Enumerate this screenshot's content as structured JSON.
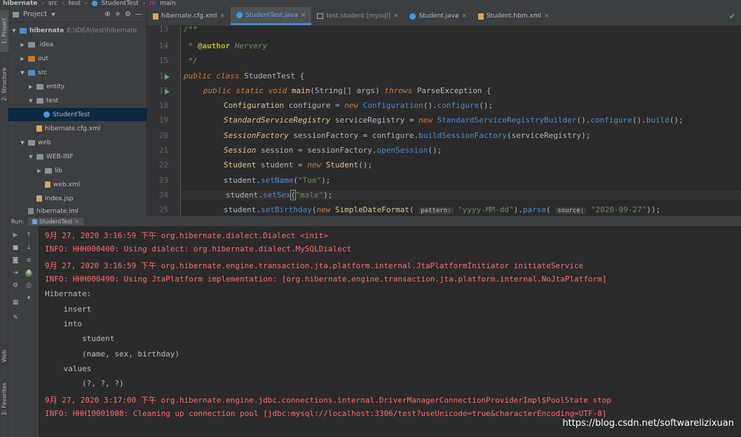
{
  "breadcrumb": [
    "hibernate",
    "src",
    "test",
    "StudentTest",
    "main"
  ],
  "left_tabs": [
    "1: Project",
    "2: Structure",
    "Web",
    "2: Favorites"
  ],
  "project_panel": {
    "title": "Project",
    "tree": [
      {
        "label": "hibernate",
        "path": "E:\\IDEA\\test\\hibernate"
      },
      {
        "label": ".idea"
      },
      {
        "label": "out"
      },
      {
        "label": "src"
      },
      {
        "label": "entity"
      },
      {
        "label": "test"
      },
      {
        "label": "StudentTest"
      },
      {
        "label": "hibernate.cfg.xml"
      },
      {
        "label": "web"
      },
      {
        "label": "WEB-INF"
      },
      {
        "label": "lib"
      },
      {
        "label": "web.xml"
      },
      {
        "label": "index.jsp"
      },
      {
        "label": "hibernate.iml"
      }
    ]
  },
  "tabs": [
    {
      "label": "hibernate.cfg.xml"
    },
    {
      "label": "StudentTest.java"
    },
    {
      "label": "test.student [mysql]"
    },
    {
      "label": "Student.java"
    },
    {
      "label": "Student.hbm.xml"
    }
  ],
  "editor": {
    "line_numbers": [
      "13",
      "14",
      "15",
      "16",
      "17",
      "18",
      "19",
      "20",
      "21",
      "22",
      "23",
      "24",
      "25"
    ],
    "lines": {
      "l13": "/**",
      "l14_star": " * ",
      "l14_tag": "@author",
      "l14_name": " Hervery",
      "l15": " */",
      "l16_kw1": "public",
      "l16_kw2": "class",
      "l16_name": " StudentTest {",
      "l17_kw1": "public",
      "l17_kw2": "static",
      "l17_kw3": "void",
      "l17_m": "main",
      "l17_p1": "(String[] args) ",
      "l17_kw4": "throws",
      "l17_ex": "ParseException",
      "l17_end": " {",
      "l18_t": "Configuration",
      "l18_v": " configure = ",
      "l18_new": "new",
      "l18_c": "Configuration",
      "l18_p": "().",
      "l18_m": "configure",
      "l18_e": "();",
      "l19_t": "StandardServiceRegistry",
      "l19_v": " serviceRegistry = ",
      "l19_new": "new",
      "l19_c": "StandardServiceRegistryBuilder",
      "l19_p1": "().",
      "l19_m1": "configure",
      "l19_p2": "().",
      "l19_m2": "build",
      "l19_e": "();",
      "l20_t": "SessionFactory",
      "l20_v": " sessionFactory = configure.",
      "l20_m": "buildSessionFactory",
      "l20_e": "(serviceRegistry);",
      "l21_t": "Session",
      "l21_v": " session = sessionFactory.",
      "l21_m": "openSession",
      "l21_e": "();",
      "l22_t": "Student",
      "l22_v": " student = ",
      "l22_new": "new",
      "l22_c": "Student",
      "l22_e": "();",
      "l23_v": "student.",
      "l23_m": "setName",
      "l23_p": "(",
      "l23_s": "\"Tom\"",
      "l23_e": ");",
      "l24_v": "student.",
      "l24_m": "setSex",
      "l24_p": "(",
      "l24_s": "\"male\"",
      "l24_e": ");",
      "l25_v": "student.",
      "l25_m": "setBirthday",
      "l25_p1": "(",
      "l25_new": "new",
      "l25_c": "SimpleDateFormat",
      "l25_p2": "( ",
      "l25_h1": "pattern:",
      "l25_s1": " \"yyyy-MM-dd\"",
      "l25_p3": ").",
      "l25_m2": "parse",
      "l25_p4": "( ",
      "l25_h2": "source:",
      "l25_s2": " \"2020-09-27\"",
      "l25_e": "));"
    }
  },
  "run": {
    "label": "Run:",
    "tab": "StudentTest"
  },
  "console": {
    "lines": [
      "9月 27, 2020 3:16:59 下午 org.hibernate.dialect.Dialect <init>",
      "INFO: HHH000400: Using dialect: org.hibernate.dialect.MySQLDialect",
      "9月 27, 2020 3:16:59 下午 org.hibernate.engine.transaction.jta.platform.internal.JtaPlatformInitiator initiateService",
      "INFO: HHH000490: Using JtaPlatform implementation: [org.hibernate.engine.transaction.jta.platform.internal.NoJtaPlatform]",
      "Hibernate:",
      "    insert",
      "    into",
      "        student",
      "        (name, sex, birthday)",
      "    values",
      "        (?, ?, ?)",
      "9月 27, 2020 3:17:00 下午 org.hibernate.engine.jdbc.connections.internal.DriverManagerConnectionProviderImpl$PoolState stop",
      "INFO: HHH10001008: Cleaning up connection pool [jdbc:mysql://localhost:3306/test?useUnicode=true&characterEncoding=UTF-8]"
    ]
  },
  "watermark": "https://blog.csdn.net/softwarelizixuan",
  "colors": {
    "background": "#2b2b2b",
    "panel": "#3c3f41",
    "log_red": "#ff6b68",
    "keyword": "#cc7832",
    "string": "#6a8759",
    "method": "#ffc66d"
  }
}
